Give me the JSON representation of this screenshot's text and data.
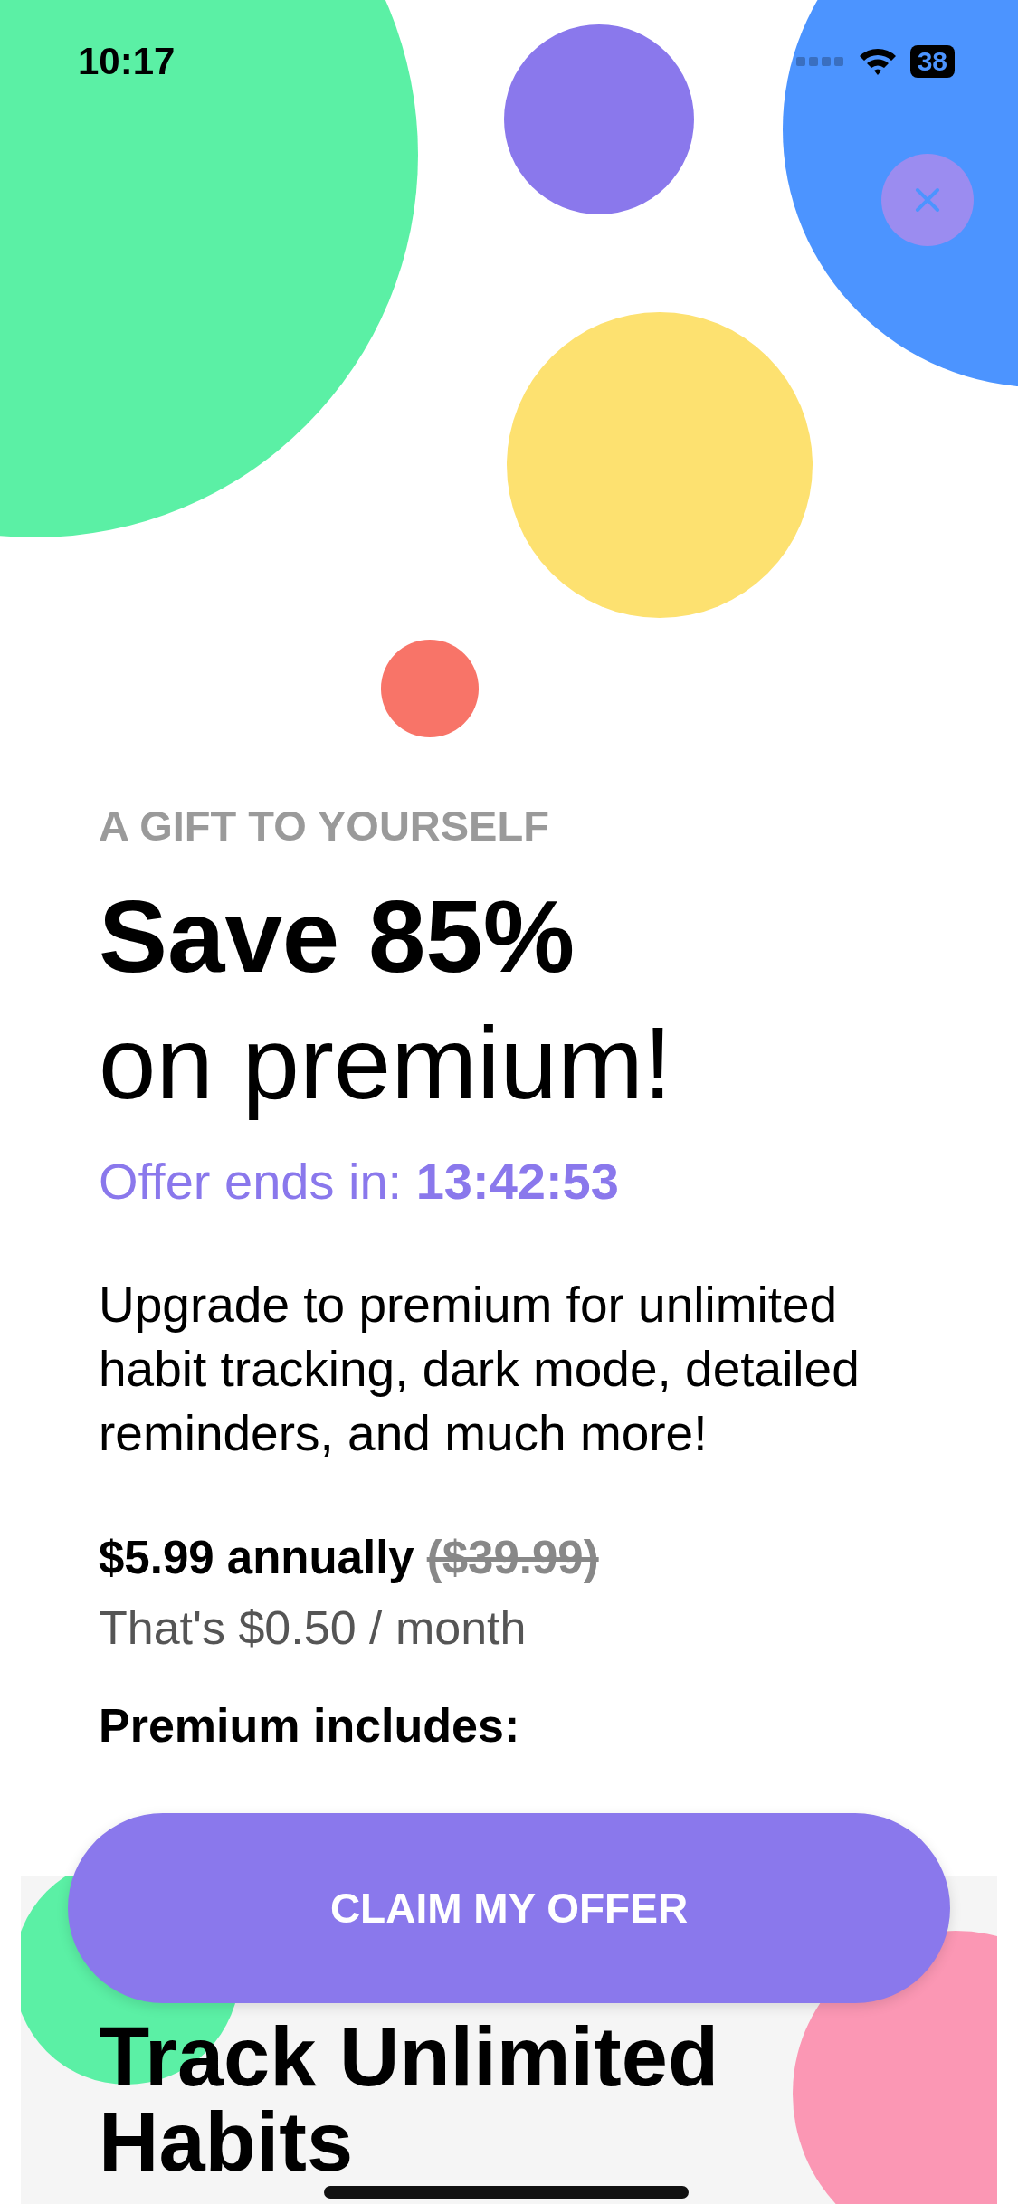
{
  "status_bar": {
    "time": "10:17",
    "battery": "38"
  },
  "offer": {
    "eyebrow": "A GIFT TO YOURSELF",
    "title_bold": "Save 85%",
    "title_rest": "on premium!",
    "countdown": "Offer ends in: **13:42:53**"
  },
  "description": "Upgrade to premium for unlimited habit tracking, dark mode, detailed reminders, and much more!",
  "pricing": {
    "price": "$5.99 annually",
    "original_price": "($39.99)",
    "per_month": "That's $0.50 / month"
  },
  "features_heading": "Premium includes:",
  "feature_card": {
    "title": "Track Unlimited Habits"
  },
  "cta_button": "CLAIM MY OFFER"
}
